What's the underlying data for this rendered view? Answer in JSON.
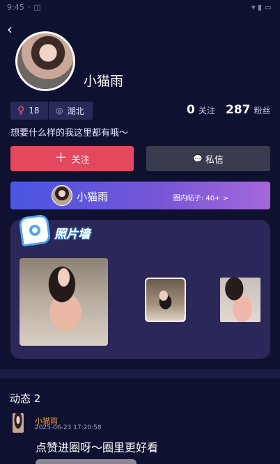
{
  "status_bar": {
    "left": "9:45 ◦ ◫",
    "right": "▾ ▮ ▭"
  },
  "header": {
    "back_icon": "chevron-left-icon"
  },
  "profile": {
    "nickname": "小猫雨",
    "gender_icon": "♀",
    "age": "18",
    "region_icon": "location-pin-icon",
    "region": "湖北",
    "following_count": "0",
    "following_label": "关注",
    "fans_count": "287",
    "fans_label": "粉丝",
    "bio": "想要什么样的我这里都有哦～"
  },
  "actions": {
    "follow_icon": "＋",
    "follow_label": "关注",
    "message_icon": "💬",
    "message_label": "私信"
  },
  "circle": {
    "name": "小猫雨",
    "posts_label": "圈内帖子: 40+ >"
  },
  "photo_wall": {
    "title": "照片墙",
    "photos_count": 3
  },
  "dynamic": {
    "header": "动态 2",
    "posts": [
      {
        "author": "小猫雨",
        "time": "2025-06-23 17:20:58",
        "text": "点赞进圈呀～圈里更好看"
      }
    ]
  },
  "colors": {
    "background": "#0f1130",
    "follow_button": "#e3485f",
    "message_button": "#383c4e",
    "tag_bg": "#262c57",
    "photo_card_bg": "#2b2759",
    "author_name": "#e59a3a"
  }
}
